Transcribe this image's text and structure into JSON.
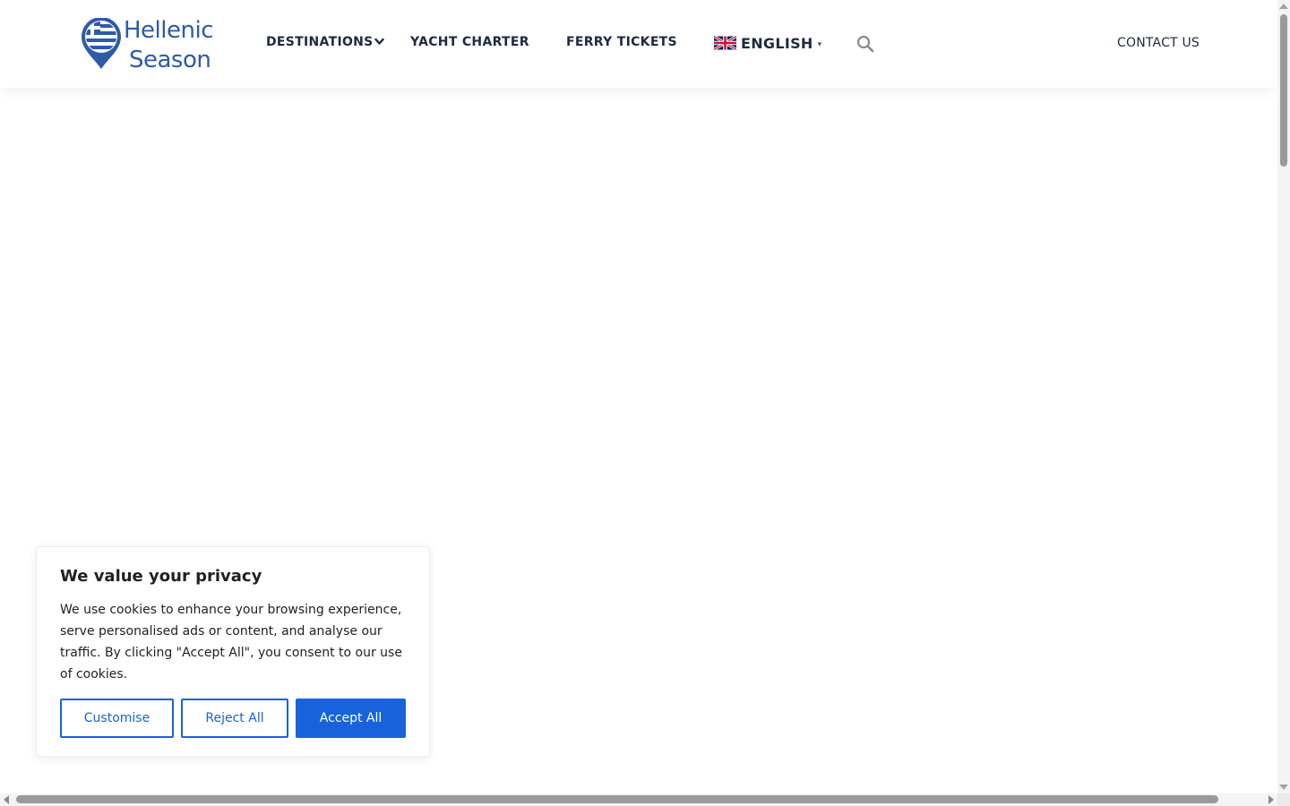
{
  "header": {
    "logo_line1": "Hellenic",
    "logo_line2": "Season",
    "nav": {
      "destinations": "DESTINATIONS",
      "yacht_charter": "YACHT CHARTER",
      "ferry_tickets": "FERRY TICKETS"
    },
    "language": {
      "label": "ENGLISH",
      "caret": "▾",
      "flag_icon": "uk-flag-icon"
    },
    "search_icon": "search-icon",
    "contact": "CONTACT US"
  },
  "cookie_banner": {
    "title": "We value your privacy",
    "body": "We use cookies to enhance your browsing experience, serve personalised ads or content, and analyse our traffic. By clicking \"Accept All\", you consent to our use of cookies.",
    "customise": "Customise",
    "reject_all": "Reject All",
    "accept_all": "Accept All"
  },
  "colors": {
    "brand_blue": "#2f5aa8",
    "nav_text": "#1e2a3e",
    "button_blue": "#1863dc"
  }
}
